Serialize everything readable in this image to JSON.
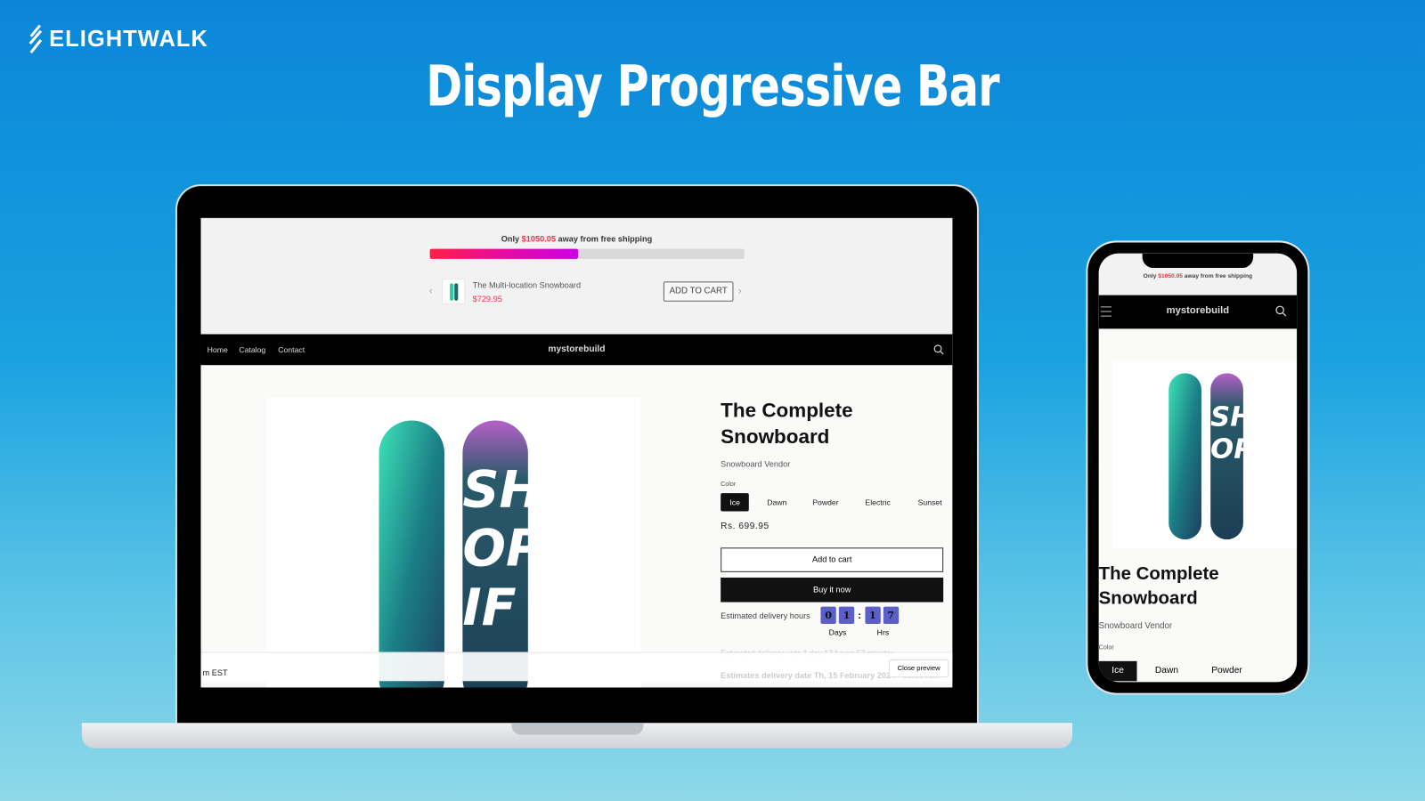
{
  "brand": {
    "logo_text": "ELIGHTWALK"
  },
  "headline": "Display Progressive Bar",
  "colors": {
    "accent_red": "#f0304a",
    "bar_start": "#ff1f45",
    "bar_end": "#cc00e6",
    "countdown": "#5b5fc7"
  },
  "shipping_bar": {
    "prefix": "Only ",
    "amount": "$1050.05",
    "suffix": " away from free shipping",
    "progress_percent": 47,
    "upsell": {
      "name": "The Multi-location Snowboard",
      "price": "$729.95",
      "button": "ADD TO CART"
    }
  },
  "nav": {
    "links": [
      "Home",
      "Catalog",
      "Contact"
    ],
    "store_name": "mystorebuild"
  },
  "product": {
    "title_line1": "The Complete",
    "title_line2": "Snowboard",
    "vendor": "Snowboard Vendor",
    "color_label": "Color",
    "colors": [
      "Ice",
      "Dawn",
      "Powder",
      "Electric",
      "Sunset"
    ],
    "selected_color": "Ice",
    "price": "Rs. 699.95",
    "add_to_cart": "Add to cart",
    "buy_now": "Buy it now",
    "delivery_label": "Estimated delivery hours",
    "countdown_digits": [
      "0",
      "1",
      "1",
      "7"
    ],
    "days_label": "Days",
    "hrs_label": "Hrs",
    "delivery_upto": "Estimated delivery upto 1 day 17 hours 57 minutes",
    "delivery_date": "Estimates delivery date Th, 15 February 2024 - 08:00 AM"
  },
  "preview": {
    "left_text": "m EST",
    "close": "Close preview"
  }
}
